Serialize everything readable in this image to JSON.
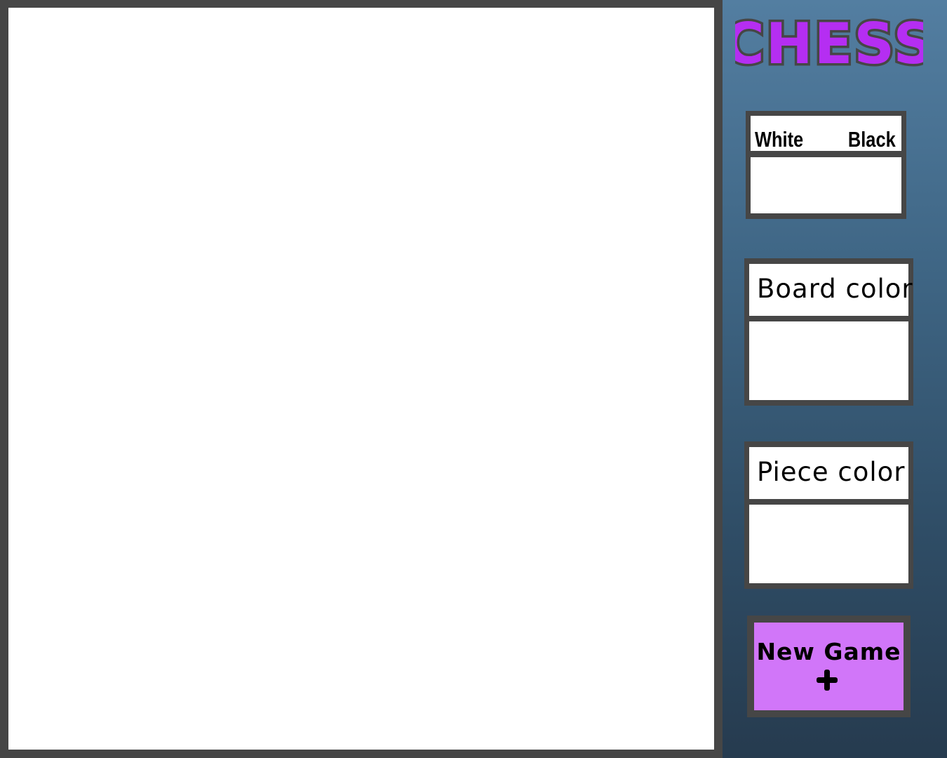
{
  "app": {
    "title": "CHESS"
  },
  "moves_table": {
    "white_label": "White",
    "black_label": "Black",
    "moves": []
  },
  "board_color": {
    "title": "Board color",
    "options": []
  },
  "piece_color": {
    "title": "Piece color",
    "options": []
  },
  "new_game": {
    "label": "New Game",
    "icon": "plus-icon"
  },
  "colors": {
    "frame": "#464646",
    "logo_fill": "#b52ef2",
    "logo_outline": "#464646",
    "button_fill": "#d176f9",
    "sidebar_top": "#537ea1",
    "sidebar_bottom": "#263b4f"
  }
}
